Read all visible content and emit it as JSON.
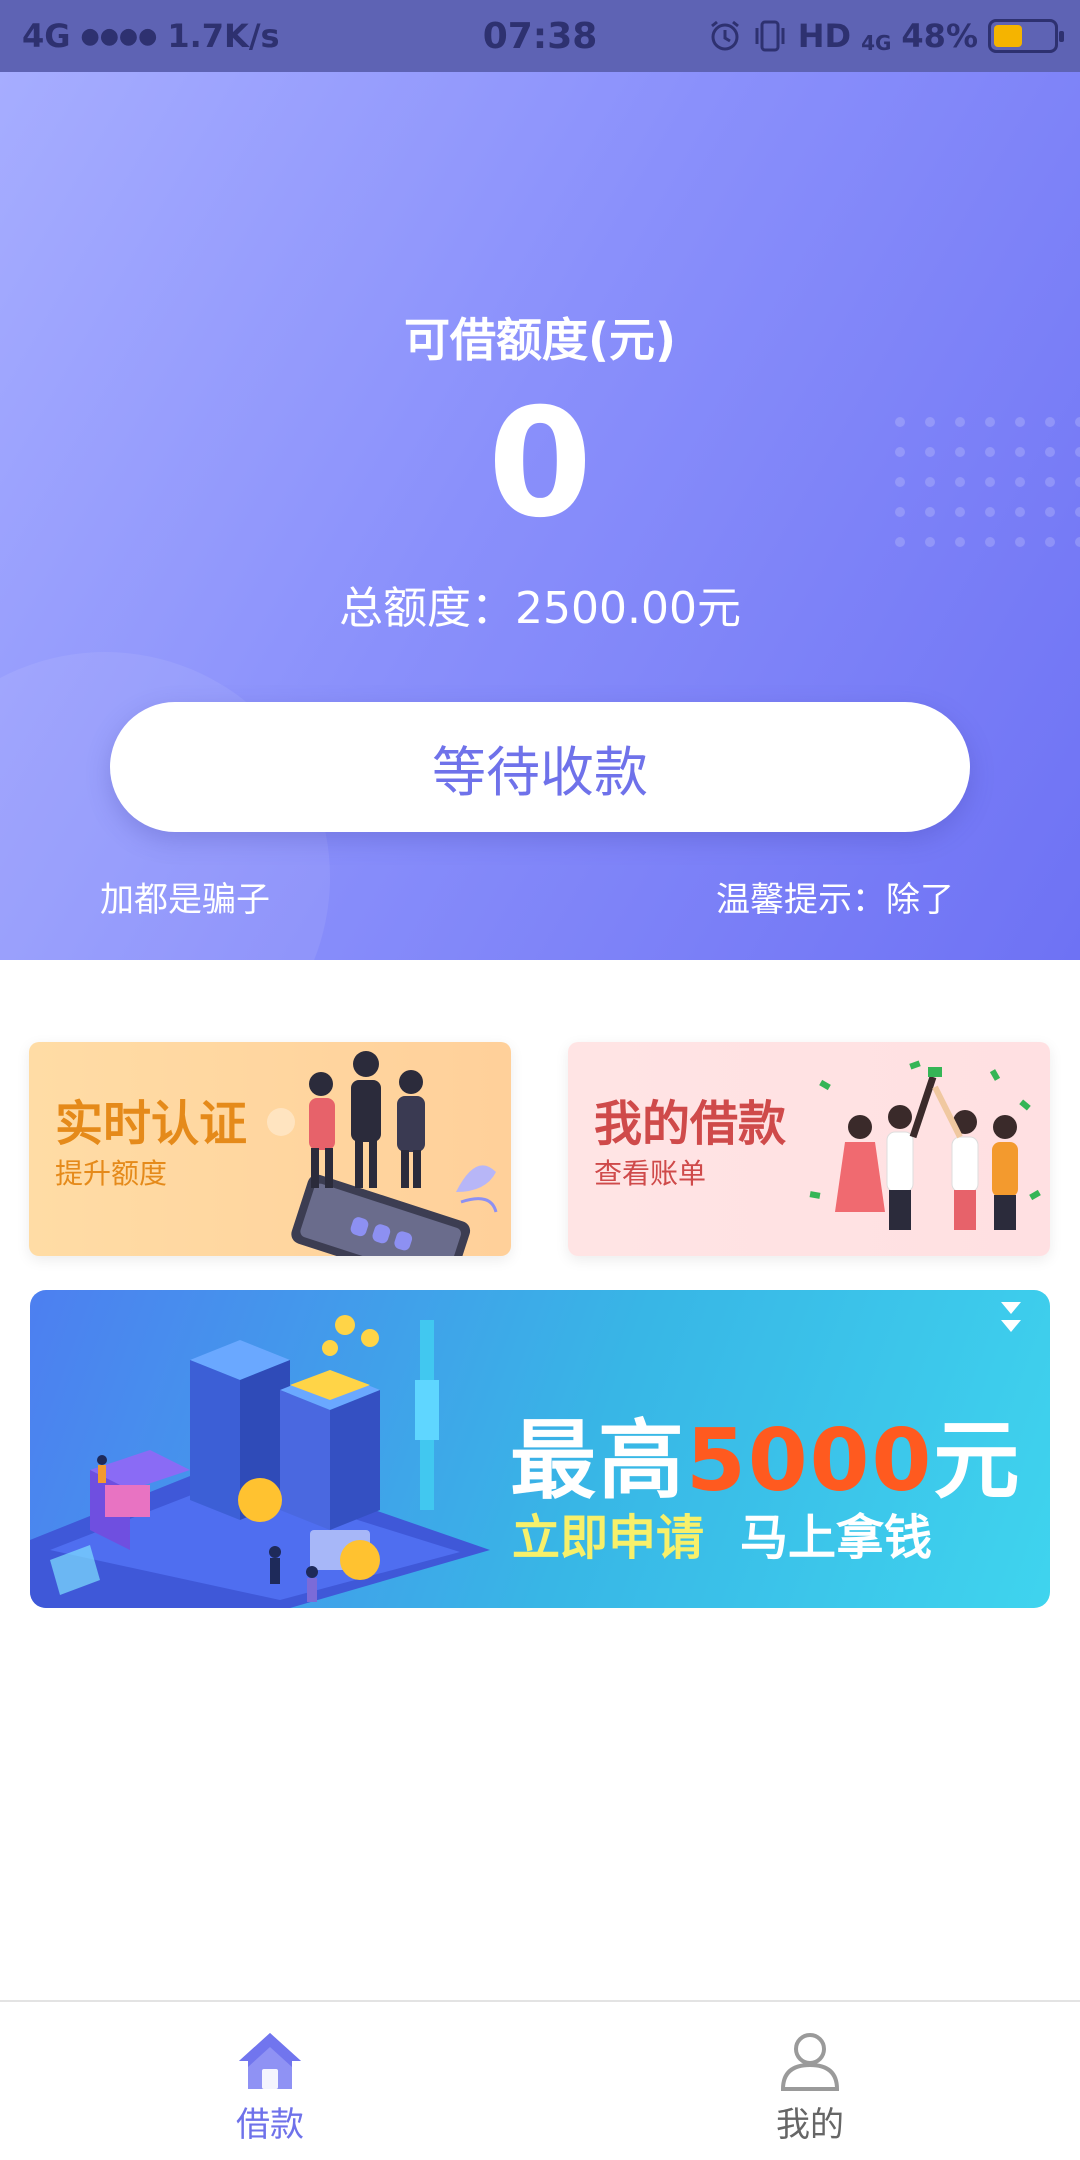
{
  "status_bar": {
    "network": "4G",
    "signal": "●●●●",
    "speed": "1.7K/s",
    "time": "07:38",
    "hd": "HD",
    "net_type": "4G",
    "battery": "48%",
    "battery_level": 0.48
  },
  "hero": {
    "title": "可借额度(元)",
    "amount": "0",
    "total": "总额度：2500.00元",
    "button_label": "等待收款",
    "marquee_left": "加都是骗子",
    "marquee_right": "温馨提示：除了"
  },
  "cards": {
    "auth": {
      "title": "实时认证",
      "subtitle": "提升额度"
    },
    "loan": {
      "title": "我的借款",
      "subtitle": "查看账单"
    }
  },
  "banner": {
    "prefix": "最高",
    "amount": "5000",
    "suffix": "元",
    "cta1": "立即申请",
    "cta2": "马上拿钱"
  },
  "tabs": [
    {
      "label": "借款",
      "icon": "home-icon",
      "active": true
    },
    {
      "label": "我的",
      "icon": "user-icon",
      "active": false
    }
  ],
  "colors": {
    "accent": "#6f72ea",
    "hero_start": "#a6adff",
    "hero_end": "#6e72f4",
    "banner_highlight": "#ff5a1f"
  }
}
